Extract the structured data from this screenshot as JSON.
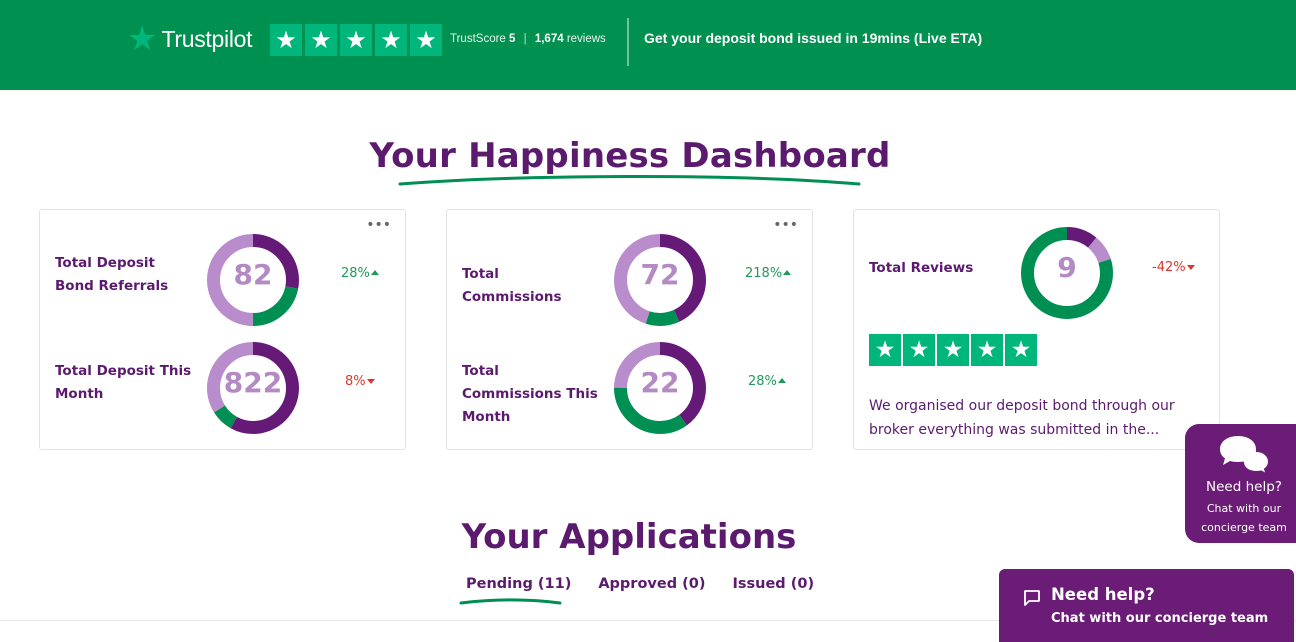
{
  "banner": {
    "logo_star": "★",
    "logo_text": "Trustpilot",
    "star_glyph": "★",
    "trustscore_label": "TrustScore",
    "trustscore_value": "5",
    "separator": "|",
    "reviews_count": "1,674",
    "reviews_label": "reviews",
    "message": "Get your deposit bond issued in 19mins (Live ETA)",
    "colors": {
      "background": "#00904f",
      "star_bg": "#00b67a"
    }
  },
  "dashboard": {
    "title": "Your Happiness Dashboard",
    "more_label": "•••",
    "cards": [
      {
        "metrics": [
          {
            "label": "Total Deposit Bond Referrals",
            "value": "82",
            "change": "28%",
            "direction": "up",
            "segments": {
              "dark": 0.28,
              "green": 0.22,
              "light": 0.5
            }
          },
          {
            "label": "Total Deposit This Month",
            "value": "822",
            "change": "8%",
            "direction": "down",
            "segments": {
              "dark": 0.58,
              "green": 0.08,
              "light": 0.34
            }
          }
        ]
      },
      {
        "metrics": [
          {
            "label": "Total Commissions",
            "value": "72",
            "change": "218%",
            "direction": "up",
            "segments": {
              "dark": 0.43,
              "green": 0.12,
              "light": 0.45
            }
          },
          {
            "label": "Total Commissions This Month",
            "value": "22",
            "change": "28%",
            "direction": "up",
            "segments": {
              "dark": 0.4,
              "green": 0.35,
              "light": 0.25
            }
          }
        ]
      },
      {
        "metrics": [
          {
            "label": "Total Reviews",
            "value": "9",
            "change": "-42%",
            "direction": "down",
            "segments": {
              "dark": 0.11,
              "light": 0.09,
              "green": 0.8
            }
          }
        ],
        "review_stars": 5,
        "review_text": "We organised our deposit bond through our broker everything was submitted in the..."
      }
    ]
  },
  "applications": {
    "title": "Your Applications",
    "tabs": [
      {
        "label": "Pending (11)",
        "active": true
      },
      {
        "label": "Approved (0)",
        "active": false
      },
      {
        "label": "Issued (0)",
        "active": false
      }
    ]
  },
  "help_side": {
    "title": "Need help?",
    "subtitle_line1": "Chat with our",
    "subtitle_line2": "concierge team"
  },
  "help_bar": {
    "title": "Need help?",
    "subtitle": "Chat with our concierge team"
  },
  "colors": {
    "purple": "#5b1a6e",
    "donut_dark": "#651a78",
    "donut_light": "#b98ccb",
    "donut_green": "#008f53",
    "up": "#1f9a5a",
    "down": "#e0342b"
  }
}
